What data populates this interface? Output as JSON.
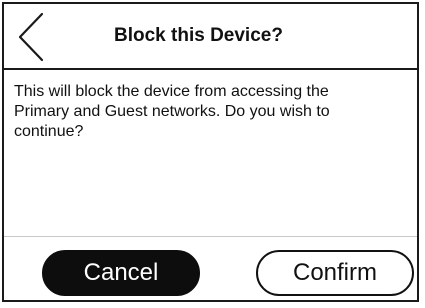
{
  "dialog": {
    "title": "Block this Device?",
    "back_icon": "chevron-left-icon",
    "message": "This will block the device from accessing the Primary and Guest networks. Do you wish to continue?",
    "cancel_label": "Cancel",
    "confirm_label": "Confirm"
  },
  "colors": {
    "border": "#1a1a1a",
    "primary_button_bg": "#0d0d0d",
    "primary_button_text": "#ffffff",
    "secondary_button_bg": "#ffffff",
    "divider": "#c8c8c8"
  }
}
